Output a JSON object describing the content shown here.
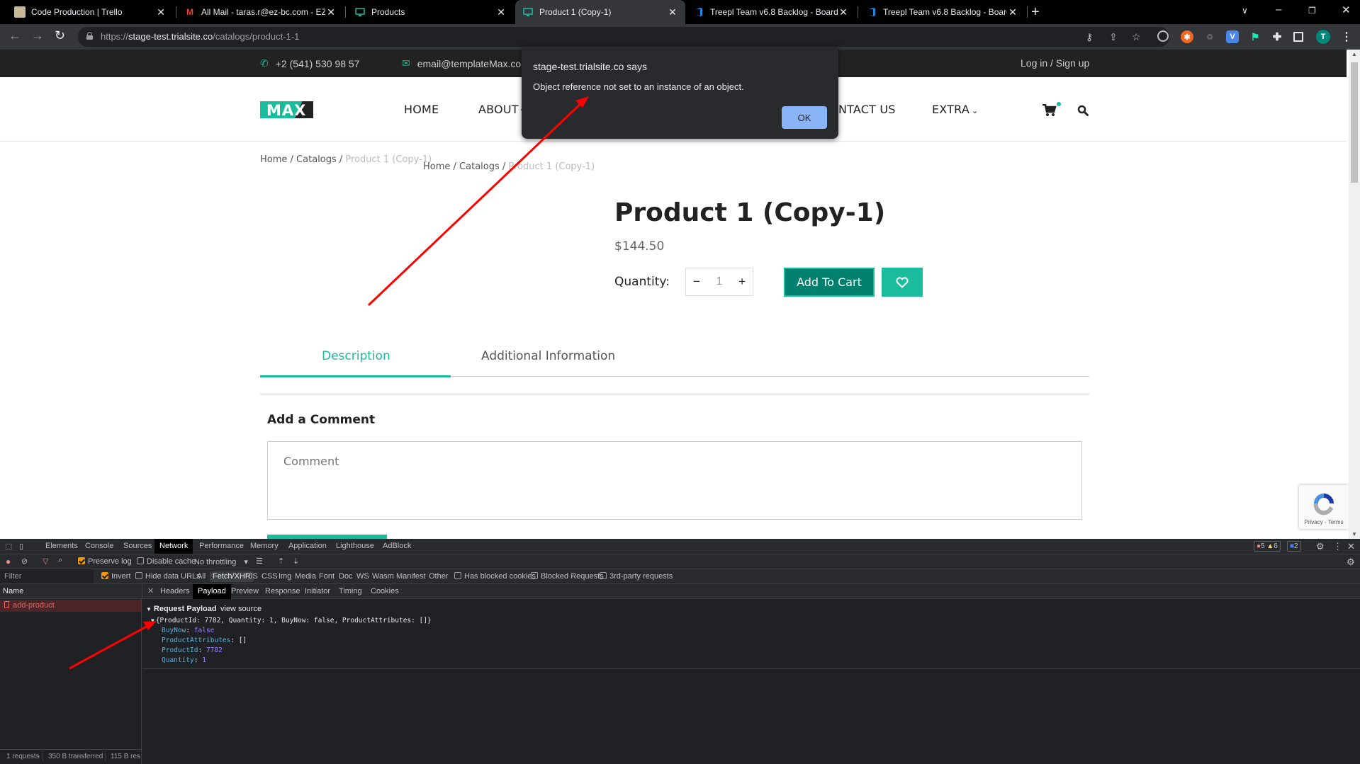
{
  "browser": {
    "tabs": [
      {
        "title": "Code Production | Trello",
        "icon": "trello-icon",
        "active": false
      },
      {
        "title": "All Mail - taras.r@ez-bc.com - EZ",
        "icon": "gmail-icon",
        "active": false
      },
      {
        "title": "Products",
        "icon": "monitor-icon",
        "active": false
      },
      {
        "title": "Product 1 (Copy-1)",
        "icon": "monitor-icon",
        "active": true
      },
      {
        "title": "Treepl Team v6.8 Backlog - Board",
        "icon": "azure-devops-icon",
        "active": false
      },
      {
        "title": "Treepl Team v6.8 Backlog - Board",
        "icon": "azure-devops-icon",
        "active": false
      }
    ],
    "url": {
      "scheme": "https://",
      "host": "stage-test.trialsite.co",
      "path": "/catalogs/product-1-1"
    },
    "profile_initial": "T",
    "extension_v_label": "V"
  },
  "site": {
    "phone": "+2 (541) 530 98 57",
    "email": "email@templateMax.co",
    "login": "Log in / Sign up",
    "logo": "MAX",
    "nav": {
      "home": "HOME",
      "about": "ABOUT",
      "contact": "NTACT US",
      "extra": "EXTRA"
    },
    "breadcrumb": {
      "home": "Home",
      "sep": " / ",
      "catalogs": "Catalogs",
      "current": "Product 1 (Copy-1)"
    },
    "product": {
      "title": "Product 1 (Copy-1)",
      "price": "$144.50",
      "quantity_label": "Quantity:",
      "quantity": "1",
      "minus": "−",
      "plus": "+",
      "add_to_cart": "Add To Cart"
    },
    "tabs": {
      "description": "Description",
      "additional": "Additional Information"
    },
    "comment": {
      "heading": "Add a Comment",
      "placeholder": "Comment"
    },
    "recaptcha": "Privacy - Terms",
    "colors": {
      "accent": "#1abc9c",
      "accent_dark": "#00806d"
    }
  },
  "dialog": {
    "origin": "stage-test.trialsite.co says",
    "message": "Object reference not set to an instance of an object.",
    "ok": "OK"
  },
  "devtools": {
    "panels": [
      "Elements",
      "Console",
      "Sources",
      "Network",
      "Performance",
      "Memory",
      "Application",
      "Lighthouse",
      "AdBlock"
    ],
    "active_panel": "Network",
    "issues": {
      "errors": "5",
      "warnings": "6",
      "messages": "2"
    },
    "toolbar": {
      "preserve_log": "Preserve log",
      "disable_cache": "Disable cache",
      "throttling": "No throttling"
    },
    "filter": {
      "placeholder": "Filter",
      "invert": "Invert",
      "hide_data_urls": "Hide data URLs",
      "types": [
        "All",
        "Fetch/XHR",
        "JS",
        "CSS",
        "Img",
        "Media",
        "Font",
        "Doc",
        "WS",
        "Wasm",
        "Manifest",
        "Other"
      ],
      "active_type": "Fetch/XHR",
      "has_blocked_cookies": "Has blocked cookies",
      "blocked_requests": "Blocked Requests",
      "third_party": "3rd-party requests"
    },
    "name_header": "Name",
    "request": "add-product",
    "detail_tabs": [
      "Headers",
      "Payload",
      "Preview",
      "Response",
      "Initiator",
      "Timing",
      "Cookies"
    ],
    "active_detail_tab": "Payload",
    "payload": {
      "section": "Request Payload",
      "view_source": "view source",
      "summary": "{ProductId: 7782, Quantity: 1, BuyNow: false, ProductAttributes: []}",
      "fields": [
        {
          "key": "BuyNow",
          "value": "false"
        },
        {
          "key": "ProductAttributes",
          "value": "[]"
        },
        {
          "key": "ProductId",
          "value": "7782"
        },
        {
          "key": "Quantity",
          "value": "1"
        }
      ]
    },
    "status": {
      "requests": "1 requests",
      "transferred": "350 B transferred",
      "resources": "115 B res"
    }
  }
}
